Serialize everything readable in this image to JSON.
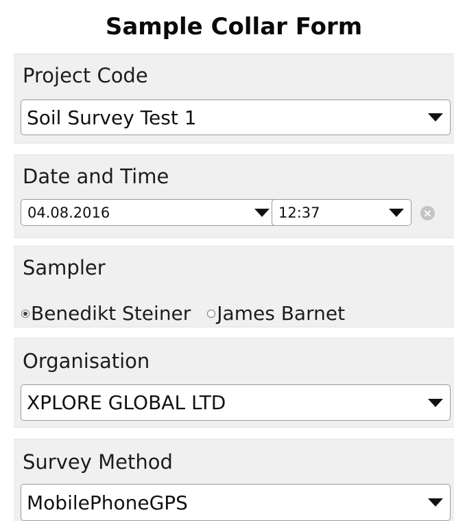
{
  "form": {
    "title": "Sample Collar Form"
  },
  "project": {
    "label": "Project Code",
    "value": "Soil Survey Test 1"
  },
  "datetime": {
    "label": "Date and Time",
    "date": "04.08.2016",
    "time": "12:37"
  },
  "sampler": {
    "label": "Sampler",
    "options": [
      {
        "label": "Benedikt Steiner",
        "checked": true
      },
      {
        "label": "James Barnet",
        "checked": false
      }
    ]
  },
  "organisation": {
    "label": "Organisation",
    "value": "XPLORE GLOBAL LTD"
  },
  "survey": {
    "label": "Survey Method",
    "value": "MobilePhoneGPS"
  },
  "icons": {
    "dropdown": "chevron-down-icon",
    "clear": "clear-icon",
    "radio_on": "radio-checked-icon",
    "radio_off": "radio-unchecked-icon"
  }
}
